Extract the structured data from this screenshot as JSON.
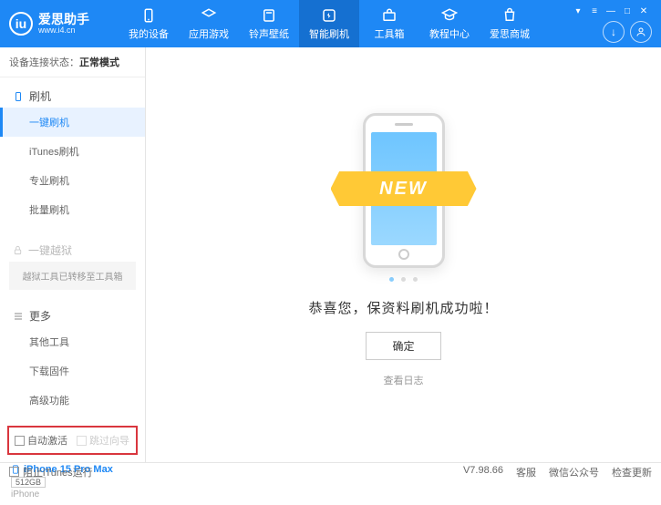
{
  "app": {
    "title": "爱思助手",
    "url": "www.i4.cn"
  },
  "nav": {
    "items": [
      {
        "label": "我的设备"
      },
      {
        "label": "应用游戏"
      },
      {
        "label": "铃声壁纸"
      },
      {
        "label": "智能刷机"
      },
      {
        "label": "工具箱"
      },
      {
        "label": "教程中心"
      },
      {
        "label": "爱思商城"
      }
    ]
  },
  "status": {
    "label": "设备连接状态：",
    "value": "正常模式"
  },
  "sidebar": {
    "flash": {
      "header": "刷机",
      "items": [
        "一键刷机",
        "iTunes刷机",
        "专业刷机",
        "批量刷机"
      ]
    },
    "jailbreak": {
      "header": "一键越狱",
      "note": "越狱工具已转移至工具箱"
    },
    "more": {
      "header": "更多",
      "items": [
        "其他工具",
        "下载固件",
        "高级功能"
      ]
    }
  },
  "options": {
    "auto_activate": "自动激活",
    "skip_guide": "跳过向导"
  },
  "device": {
    "name": "iPhone 15 Pro Max",
    "storage": "512GB",
    "type": "iPhone"
  },
  "main": {
    "new_badge": "NEW",
    "message": "恭喜您，保资料刷机成功啦！",
    "ok": "确定",
    "log": "查看日志"
  },
  "footer": {
    "block_itunes": "阻止iTunes运行",
    "version": "V7.98.66",
    "links": [
      "客服",
      "微信公众号",
      "检查更新"
    ]
  }
}
